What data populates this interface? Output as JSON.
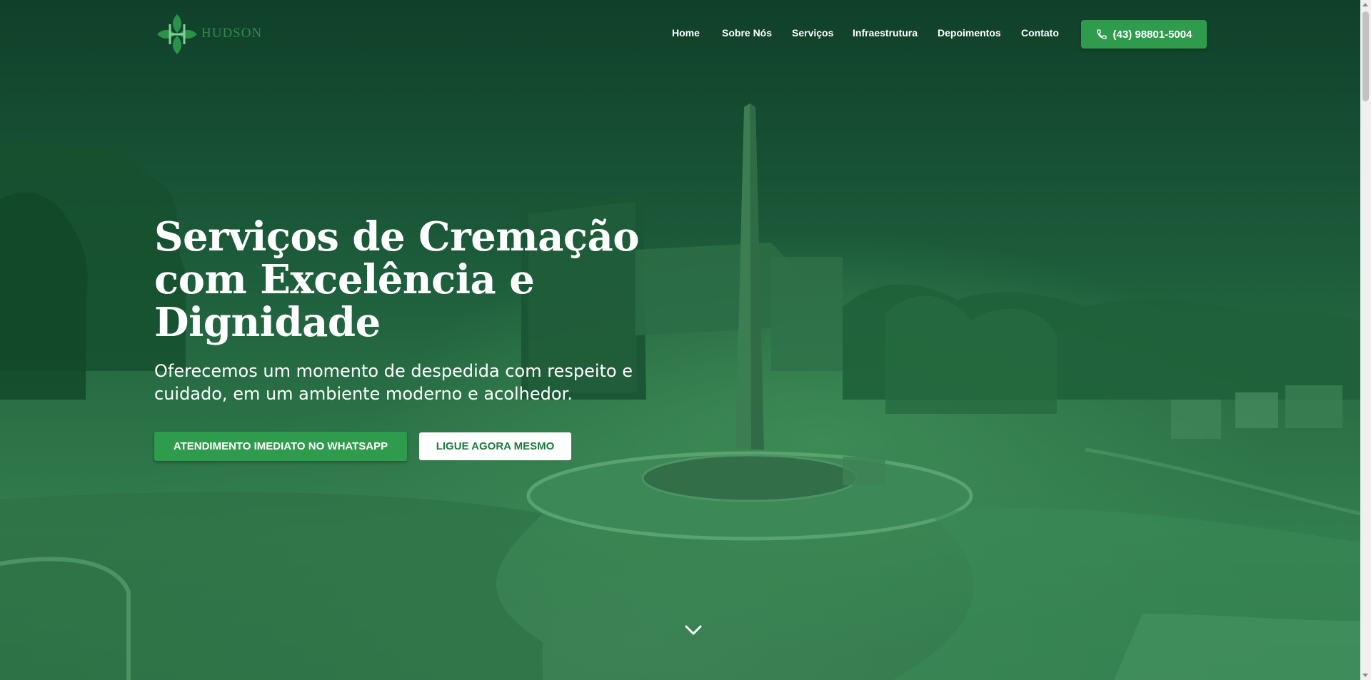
{
  "brand": {
    "name": "HUDSON",
    "logo_icon": "clover-h-logo-icon"
  },
  "nav": {
    "items": [
      {
        "label": "Home"
      },
      {
        "label": "Sobre Nós"
      },
      {
        "label": "Serviços"
      },
      {
        "label": "Infraestrutura"
      },
      {
        "label": "Depoimentos"
      },
      {
        "label": "Contato"
      }
    ],
    "phone_button": {
      "label": "(43) 98801-5004",
      "icon": "phone-icon"
    }
  },
  "hero": {
    "title": "Serviços de Cremação com Excelência e Dignidade",
    "subtitle": "Oferecemos um momento de despedida com respeito e cuidado, em um ambiente moderno e acolhedor.",
    "primary_cta": "ATENDIMENTO IMEDIATO NO WHATSAPP",
    "secondary_cta": "LIGUE AGORA MESMO",
    "scroll_icon": "chevron-down-icon"
  },
  "colors": {
    "overlay_green": "#1a5a36",
    "accent_green": "#2f9b4d",
    "secondary_text_green": "#1f7a3e",
    "white": "#ffffff"
  }
}
